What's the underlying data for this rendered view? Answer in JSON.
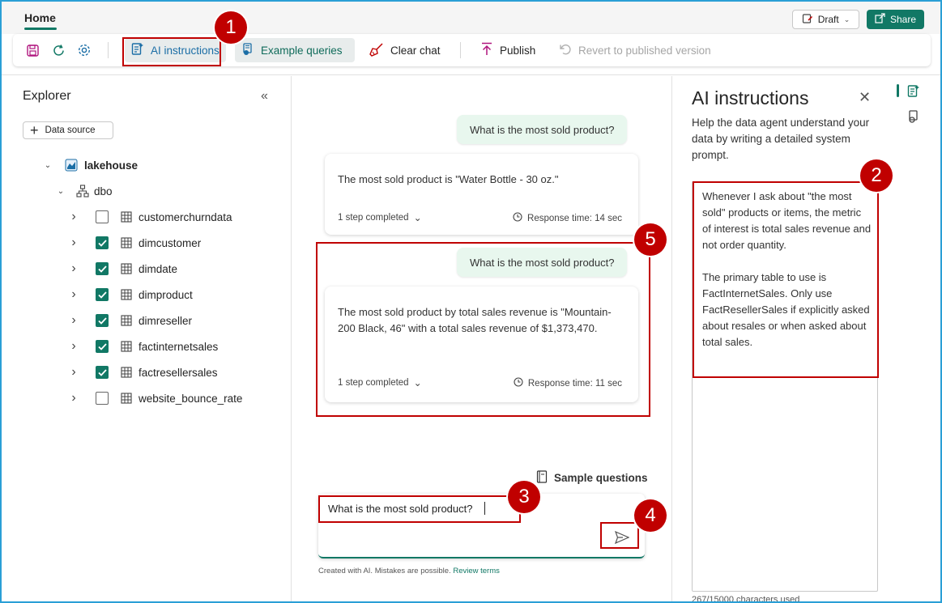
{
  "header": {
    "home_tab": "Home",
    "draft_label": "Draft",
    "share_label": "Share"
  },
  "toolbar": {
    "ai_instructions": "AI instructions",
    "example_queries": "Example queries",
    "clear_chat": "Clear chat",
    "publish": "Publish",
    "revert": "Revert to published version"
  },
  "explorer": {
    "title": "Explorer",
    "data_source_btn": "Data source",
    "lakehouse": "lakehouse",
    "schema": "dbo",
    "tables": [
      {
        "name": "customerchurndata",
        "checked": false
      },
      {
        "name": "dimcustomer",
        "checked": true
      },
      {
        "name": "dimdate",
        "checked": true
      },
      {
        "name": "dimproduct",
        "checked": true
      },
      {
        "name": "dimreseller",
        "checked": true
      },
      {
        "name": "factinternetsales",
        "checked": true
      },
      {
        "name": "factresellersales",
        "checked": true
      },
      {
        "name": "website_bounce_rate",
        "checked": false
      }
    ]
  },
  "chat": {
    "q1": "What is the most sold product?",
    "a1": "The most sold product is \"Water Bottle - 30 oz.\"",
    "a1_steps": "1 step completed",
    "a1_time": "Response time: 14 sec",
    "q2": "What is the most sold product?",
    "a2": "The most sold product by total sales revenue is \"Mountain-200 Black, 46\" with a total sales revenue of $1,373,470.",
    "a2_steps": "1 step completed",
    "a2_time": "Response time: 11 sec",
    "sample_questions": "Sample questions",
    "input_value": "What is the most sold product?",
    "disclaimer": "Created with AI. Mistakes are possible.",
    "review_terms": "Review terms"
  },
  "ai_panel": {
    "title": "AI instructions",
    "description": "Help the data agent understand your data by writing a detailed system prompt.",
    "instructions": "Whenever I ask about \"the most sold\" products or items, the metric of interest is total sales revenue and not order quantity.\n\nThe primary table to use is FactInternetSales. Only use FactResellerSales if explicitly asked about resales or when asked about total sales.",
    "char_count": "267/15000 characters used"
  },
  "badges": [
    "1",
    "2",
    "3",
    "4",
    "5"
  ],
  "colors": {
    "accent": "#117865",
    "annotation": "#c00000",
    "user_bubble": "#e8f7ee"
  }
}
